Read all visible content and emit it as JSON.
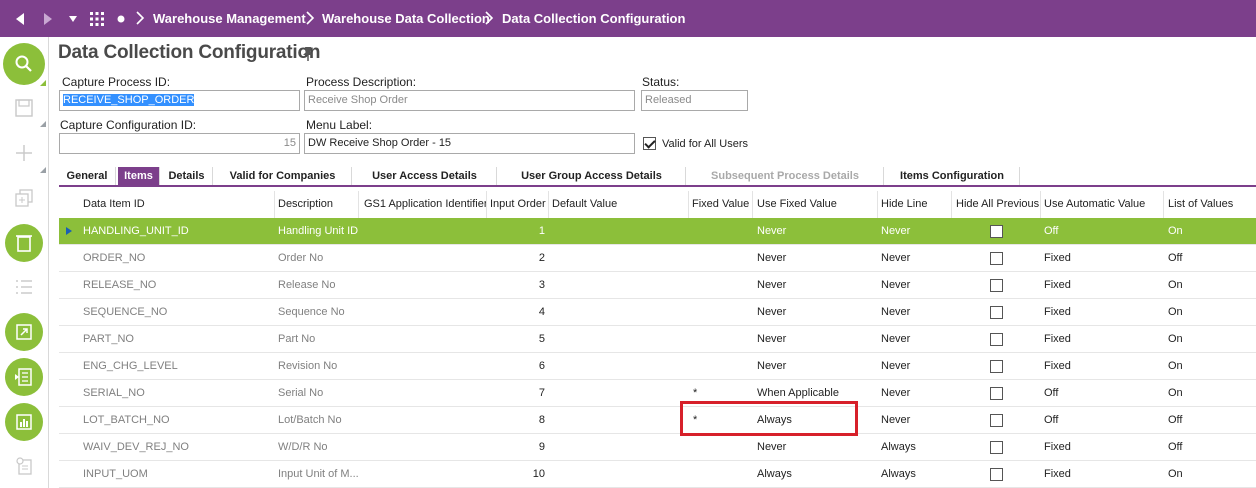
{
  "breadcrumb": {
    "items": [
      {
        "label": "Warehouse Management"
      },
      {
        "label": "Warehouse Data Collection"
      },
      {
        "label": "Data Collection Configuration"
      }
    ]
  },
  "page": {
    "title": "Data Collection Configuration"
  },
  "form": {
    "capture_process_id": {
      "label": "Capture Process ID:",
      "value": "RECEIVE_SHOP_ORDER"
    },
    "process_description": {
      "label": "Process Description:",
      "value": "Receive Shop Order"
    },
    "status": {
      "label": "Status:",
      "value": "Released"
    },
    "capture_configuration_id": {
      "label": "Capture Configuration ID:",
      "value": "15"
    },
    "menu_label": {
      "label": "Menu Label:",
      "value": "DW Receive Shop Order - 15"
    },
    "valid_for_all_users": {
      "label": "Valid for All Users",
      "checked": true
    }
  },
  "tabs": [
    {
      "label": "General"
    },
    {
      "label": "Items",
      "active": true
    },
    {
      "label": "Details"
    },
    {
      "label": "Valid for Companies"
    },
    {
      "label": "User Access Details"
    },
    {
      "label": "User Group Access Details"
    },
    {
      "label": "Subsequent Process Details",
      "disabled": true
    },
    {
      "label": "Items Configuration"
    }
  ],
  "grid": {
    "columns": [
      "Data Item ID",
      "Description",
      "GS1 Application Identifier",
      "Input Order",
      "Default Value",
      "Fixed Value",
      "Use Fixed Value",
      "Hide Line",
      "Hide All Previous",
      "Use Automatic Value",
      "List of Values"
    ],
    "rows": [
      {
        "id": "HANDLING_UNIT_ID",
        "desc": "Handling Unit ID",
        "gs1": "",
        "order": "1",
        "def": "",
        "fixed": "",
        "use_fixed": "Never",
        "hide_line": "Never",
        "hide_prev": false,
        "auto": "Off",
        "lov": "On"
      },
      {
        "id": "ORDER_NO",
        "desc": "Order No",
        "gs1": "",
        "order": "2",
        "def": "",
        "fixed": "",
        "use_fixed": "Never",
        "hide_line": "Never",
        "hide_prev": false,
        "auto": "Fixed",
        "lov": "Off"
      },
      {
        "id": "RELEASE_NO",
        "desc": "Release No",
        "gs1": "",
        "order": "3",
        "def": "",
        "fixed": "",
        "use_fixed": "Never",
        "hide_line": "Never",
        "hide_prev": false,
        "auto": "Fixed",
        "lov": "On"
      },
      {
        "id": "SEQUENCE_NO",
        "desc": "Sequence No",
        "gs1": "",
        "order": "4",
        "def": "",
        "fixed": "",
        "use_fixed": "Never",
        "hide_line": "Never",
        "hide_prev": false,
        "auto": "Fixed",
        "lov": "On"
      },
      {
        "id": "PART_NO",
        "desc": "Part No",
        "gs1": "",
        "order": "5",
        "def": "",
        "fixed": "",
        "use_fixed": "Never",
        "hide_line": "Never",
        "hide_prev": false,
        "auto": "Fixed",
        "lov": "On"
      },
      {
        "id": "ENG_CHG_LEVEL",
        "desc": "Revision No",
        "gs1": "",
        "order": "6",
        "def": "",
        "fixed": "",
        "use_fixed": "Never",
        "hide_line": "Never",
        "hide_prev": false,
        "auto": "Fixed",
        "lov": "On"
      },
      {
        "id": "SERIAL_NO",
        "desc": "Serial No",
        "gs1": "",
        "order": "7",
        "def": "",
        "fixed": "*",
        "use_fixed": "When Applicable",
        "hide_line": "Never",
        "hide_prev": false,
        "auto": "Off",
        "lov": "On"
      },
      {
        "id": "LOT_BATCH_NO",
        "desc": "Lot/Batch No",
        "gs1": "",
        "order": "8",
        "def": "",
        "fixed": "*",
        "use_fixed": "Always",
        "hide_line": "Never",
        "hide_prev": false,
        "auto": "Off",
        "lov": "Off"
      },
      {
        "id": "WAIV_DEV_REJ_NO",
        "desc": "W/D/R No",
        "gs1": "",
        "order": "9",
        "def": "",
        "fixed": "",
        "use_fixed": "Never",
        "hide_line": "Always",
        "hide_prev": false,
        "auto": "Fixed",
        "lov": "Off"
      },
      {
        "id": "INPUT_UOM",
        "desc": "Input Unit of M...",
        "gs1": "",
        "order": "10",
        "def": "",
        "fixed": "",
        "use_fixed": "Always",
        "hide_line": "Always",
        "hide_prev": false,
        "auto": "Fixed",
        "lov": "On"
      }
    ],
    "selected_row": 0
  },
  "colors": {
    "brand": "#7c3f8b",
    "accent": "#8cbf3a",
    "highlight": "#d7202a",
    "selection": "#3390ff"
  },
  "rail": {
    "icons": [
      "search-icon",
      "save-icon",
      "add-icon",
      "duplicate-icon",
      "delete-icon",
      "list-icon",
      "open-icon",
      "details-icon",
      "chart-icon",
      "report-icon"
    ]
  }
}
